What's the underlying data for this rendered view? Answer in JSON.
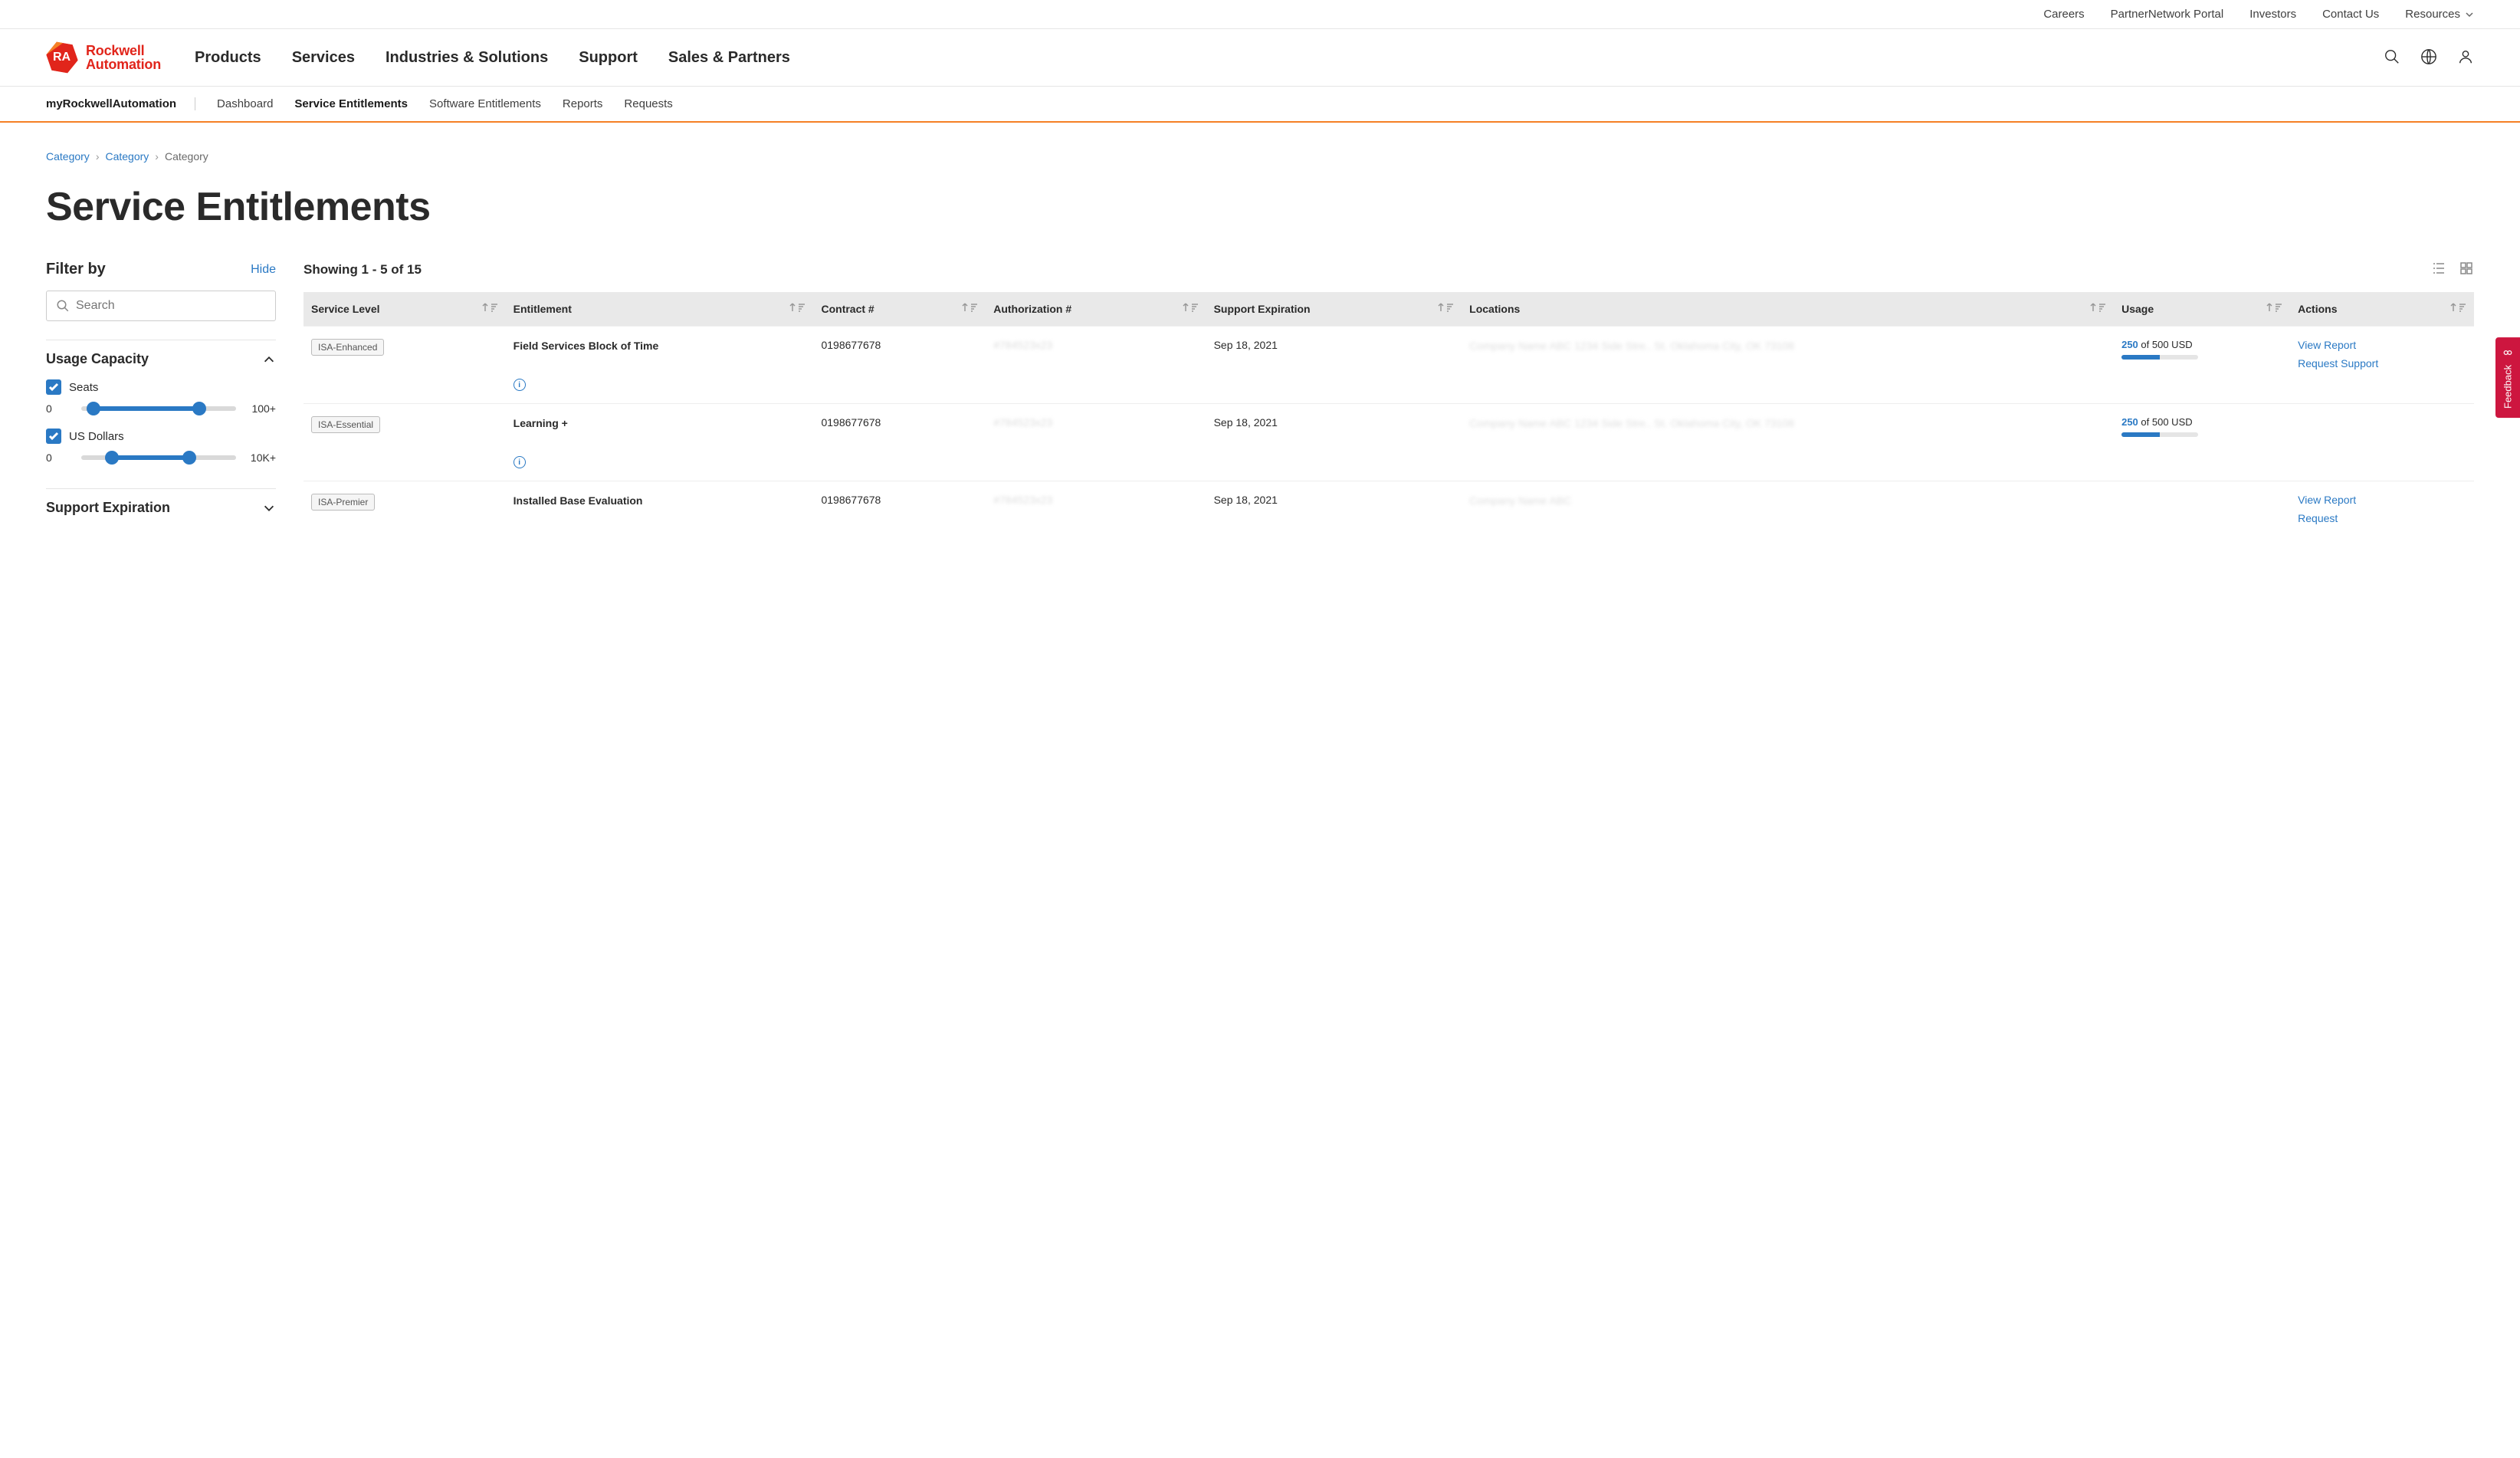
{
  "utilityNav": {
    "careers": "Careers",
    "partner": "PartnerNetwork Portal",
    "investors": "Investors",
    "contact": "Contact Us",
    "resources": "Resources"
  },
  "logo": {
    "mark": "RA",
    "line1": "Rockwell",
    "line2": "Automation"
  },
  "mainNav": {
    "products": "Products",
    "services": "Services",
    "industries": "Industries & Solutions",
    "support": "Support",
    "sales": "Sales & Partners"
  },
  "subNav": {
    "brand": "myRockwellAutomation",
    "dashboard": "Dashboard",
    "service": "Service Entitlements",
    "software": "Software Entitlements",
    "reports": "Reports",
    "requests": "Requests"
  },
  "breadcrumbs": {
    "a": "Category",
    "b": "Category",
    "c": "Category"
  },
  "pageTitle": "Service Entitlements",
  "filter": {
    "heading": "Filter by",
    "hide": "Hide",
    "searchPlaceholder": "Search",
    "sections": {
      "usage": {
        "title": "Usage Capacity",
        "seats": {
          "label": "Seats",
          "min": "0",
          "max": "100+"
        },
        "usd": {
          "label": "US Dollars",
          "min": "0",
          "max": "10K+"
        }
      },
      "expiration": {
        "title": "Support Expiration"
      }
    }
  },
  "results": {
    "showing": "Showing 1 - 5 of 15"
  },
  "table": {
    "headers": {
      "serviceLevel": "Service Level",
      "entitlement": "Entitlement",
      "contract": "Contract #",
      "authorization": "Authorization #",
      "expiration": "Support Expiration",
      "locations": "Locations",
      "usage": "Usage",
      "actions": "Actions"
    },
    "rows": [
      {
        "serviceLevel": "ISA-Enhanced",
        "entitlement": "Field Services Block of Time",
        "contract": "0198677678",
        "authorization": "#784523x23",
        "expiration": "Sep 18, 2021",
        "location": "Company Name ABC 1234 Side Stre.. St. Oklahoma City, OK 73108",
        "usage": {
          "used": "250",
          "sep": " of ",
          "total": "500 USD",
          "percent": 50
        },
        "actions": {
          "view": "View Report",
          "request": "Request Support"
        }
      },
      {
        "serviceLevel": "ISA-Essential",
        "entitlement": "Learning +",
        "contract": "0198677678",
        "authorization": "#784523x23",
        "expiration": "Sep 18, 2021",
        "location": "Company Name ABC 1234 Side Stre.. St. Oklahoma City, OK 73108",
        "usage": {
          "used": "250",
          "sep": " of ",
          "total": "500 USD",
          "percent": 50
        },
        "actions": {}
      },
      {
        "serviceLevel": "ISA-Premier",
        "entitlement": "Installed Base Evaluation",
        "contract": "0198677678",
        "authorization": "#784523x23",
        "expiration": "Sep 18, 2021",
        "location": "Company Name ABC",
        "usage": {},
        "actions": {
          "view": "View Report",
          "request": "Request"
        }
      }
    ]
  },
  "feedback": "Feedback"
}
